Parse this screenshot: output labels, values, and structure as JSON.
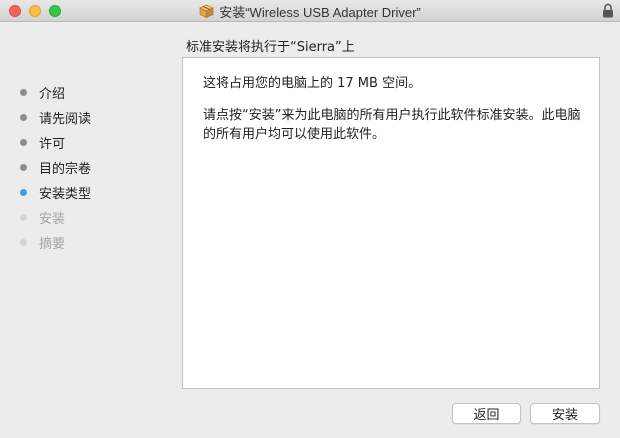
{
  "window": {
    "title": "安装“Wireless USB Adapter Driver”"
  },
  "sidebar": {
    "steps": [
      {
        "label": "介绍",
        "state": "done"
      },
      {
        "label": "请先阅读",
        "state": "done"
      },
      {
        "label": "许可",
        "state": "done"
      },
      {
        "label": "目的宗卷",
        "state": "done"
      },
      {
        "label": "安装类型",
        "state": "active"
      },
      {
        "label": "安装",
        "state": "pending"
      },
      {
        "label": "摘要",
        "state": "pending"
      }
    ]
  },
  "main": {
    "heading": "标准安装将执行于“Sierra”上",
    "space_text": "这将占用您的电脑上的 17 MB 空间。",
    "description": "请点按“安装”来为此电脑的所有用户执行此软件标准安装。此电脑的所有用户均可以使用此软件。"
  },
  "buttons": {
    "back_label": "返回",
    "install_label": "安装"
  },
  "colors": {
    "active_step": "#3b9be8",
    "done_step": "#8d8d8d",
    "pending_step": "#d4d4d4"
  }
}
